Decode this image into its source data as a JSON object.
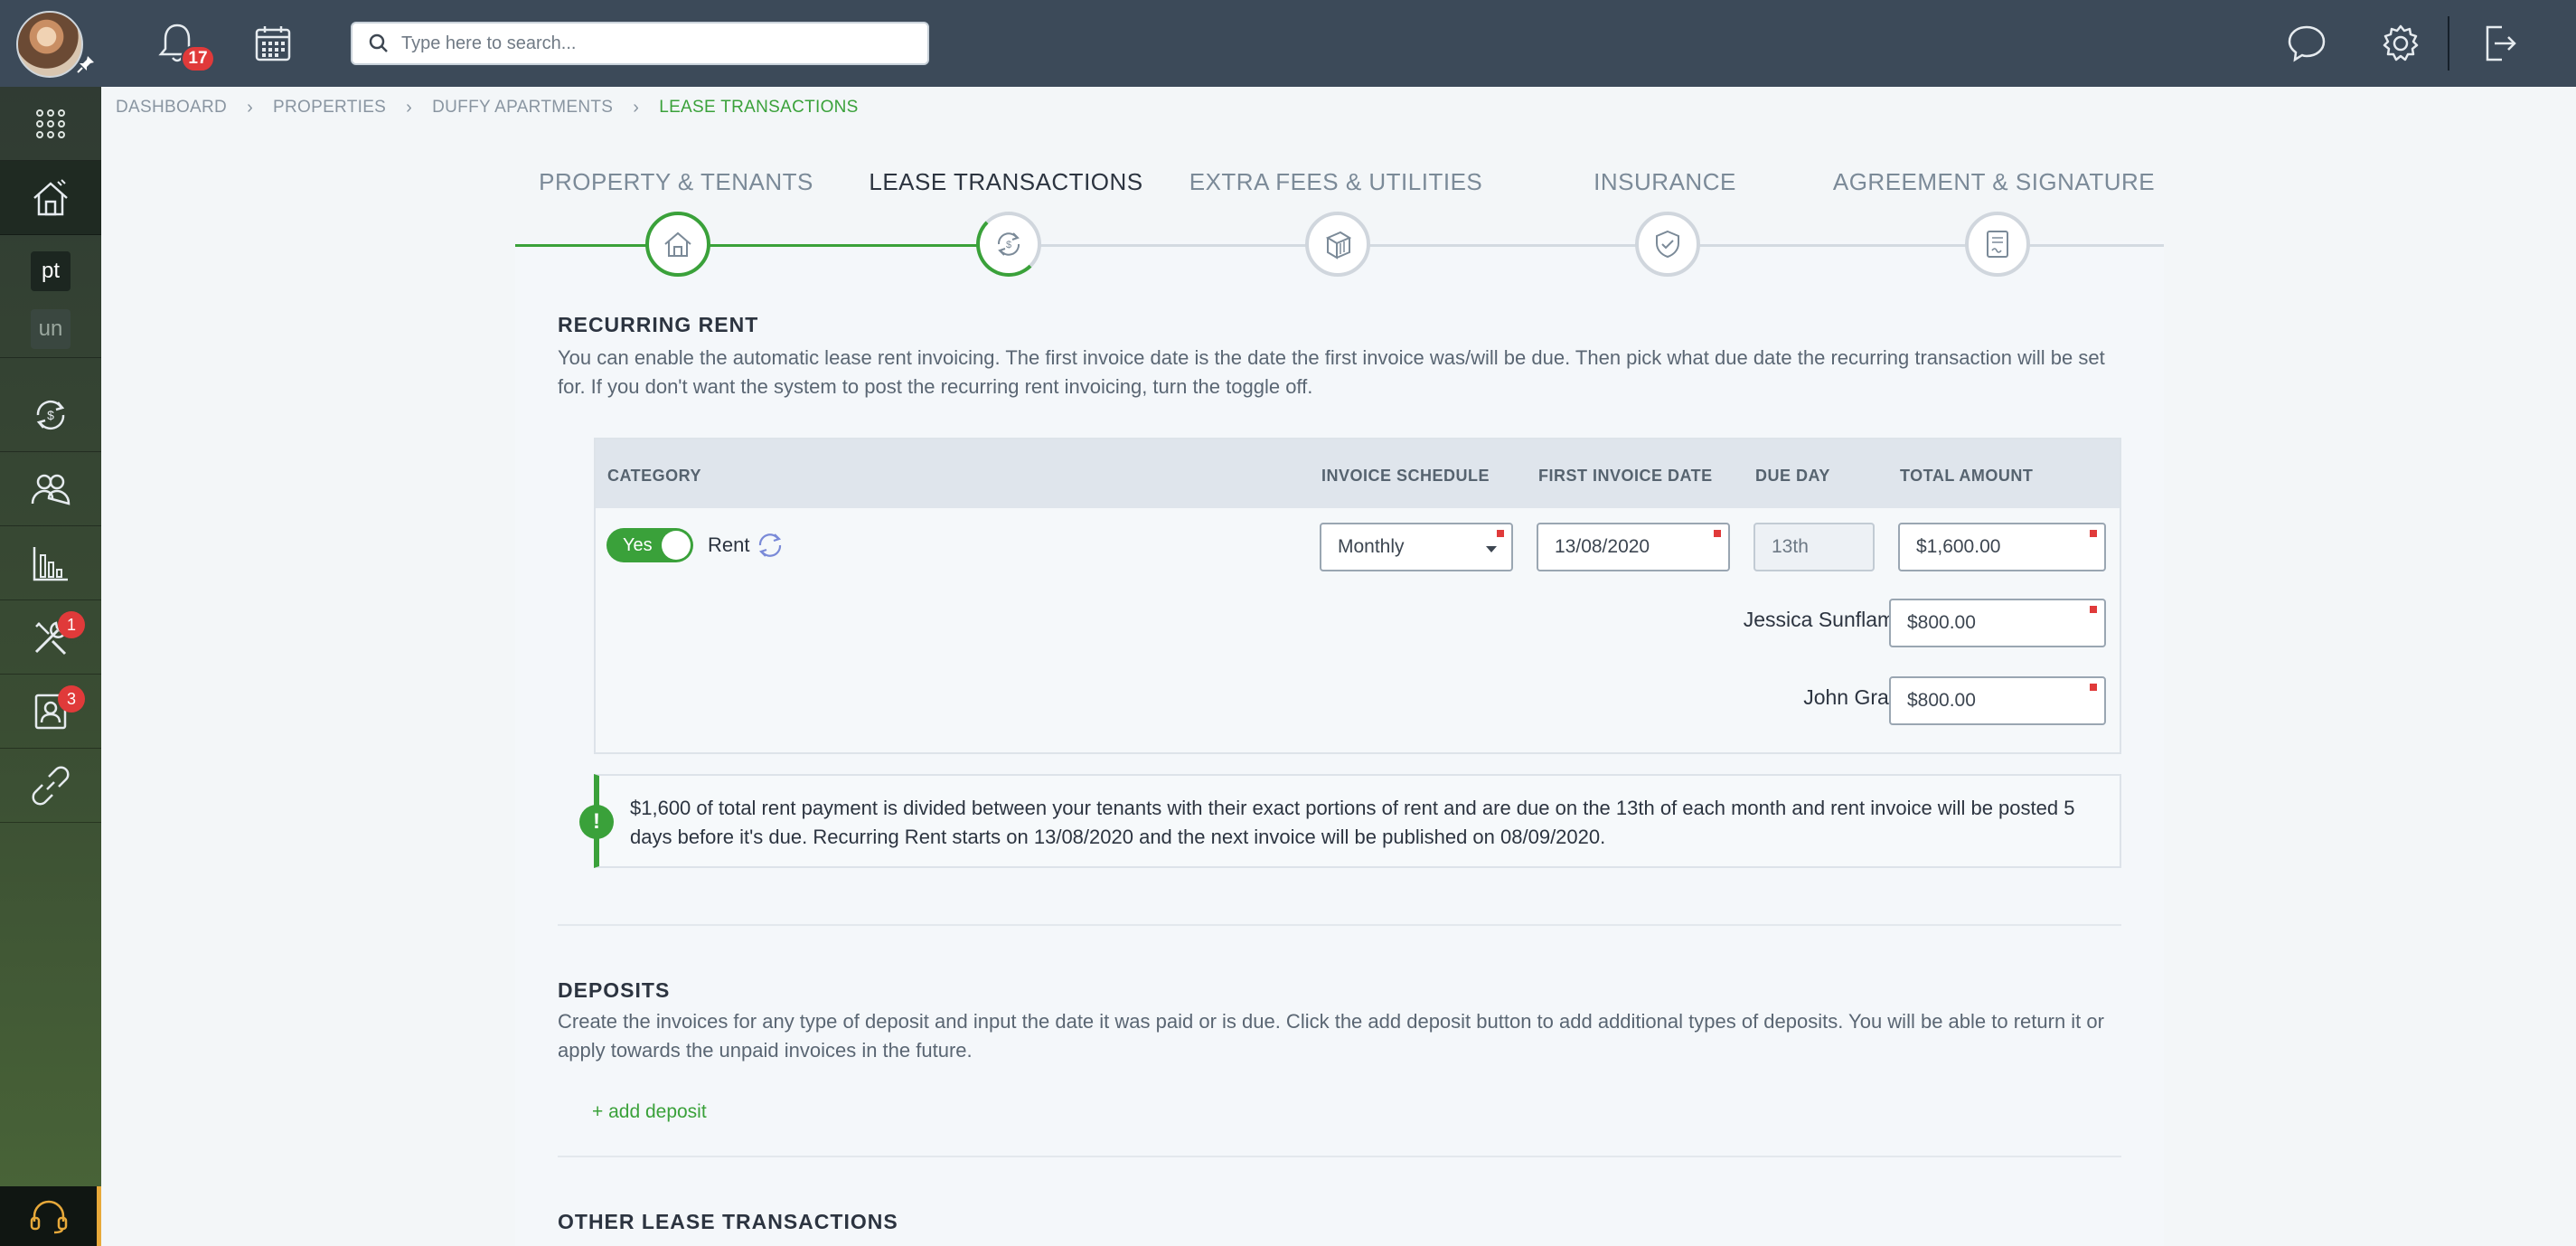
{
  "topbar": {
    "notification_count": "17",
    "search_placeholder": "Type here to search..."
  },
  "sidebar": {
    "items": [
      {
        "icon": "apps-grid-icon"
      },
      {
        "icon": "properties-icon",
        "active": true
      },
      {
        "text": "pt"
      },
      {
        "text": "un"
      },
      {
        "icon": "rent-cycle-icon"
      },
      {
        "icon": "tenants-icon"
      },
      {
        "icon": "reports-icon"
      },
      {
        "icon": "maintenance-icon",
        "badge": "1"
      },
      {
        "icon": "contacts-icon",
        "badge": "3"
      },
      {
        "icon": "link-icon"
      }
    ]
  },
  "breadcrumb": [
    "DASHBOARD",
    "PROPERTIES",
    "DUFFY APARTMENTS",
    "LEASE TRANSACTIONS"
  ],
  "steps": [
    {
      "label": "PROPERTY & TENANTS",
      "state": "done"
    },
    {
      "label": "LEASE TRANSACTIONS",
      "state": "current"
    },
    {
      "label": "EXTRA FEES & UTILITIES",
      "state": "todo"
    },
    {
      "label": "INSURANCE",
      "state": "todo"
    },
    {
      "label": "AGREEMENT & SIGNATURE",
      "state": "todo"
    }
  ],
  "recurring_rent": {
    "title": "RECURRING RENT",
    "description": "You can enable the automatic lease rent invoicing. The first invoice date is the date the first invoice was/will be due. Then pick what due date the recurring transaction will be set for. If you don't want the system to post the recurring rent invoicing, turn the toggle off.",
    "columns": [
      "CATEGORY",
      "INVOICE SCHEDULE",
      "FIRST INVOICE DATE",
      "DUE DAY",
      "TOTAL AMOUNT"
    ],
    "toggle_label": "Yes",
    "category": "Rent",
    "schedule": "Monthly",
    "first_invoice_date": "13/08/2020",
    "due_day": "13th",
    "total_amount": "$1,600.00",
    "tenants": [
      {
        "name": "Jessica Sunflame",
        "amount": "$800.00"
      },
      {
        "name": "John Grant",
        "amount": "$800.00"
      }
    ],
    "alert": "$1,600 of total rent payment is divided between your tenants with their exact portions of rent and are due on the 13th of each month and rent invoice will be posted 5 days before it's due. Recurring Rent starts on 13/08/2020 and the next invoice will be published on 08/09/2020."
  },
  "deposits": {
    "title": "DEPOSITS",
    "description": "Create the invoices for any type of deposit and input the date it was paid or is due. Click the add deposit button to add additional types of deposits. You will be able to return it or apply towards the unpaid invoices in the future.",
    "add_label": "+ add deposit"
  },
  "other_transactions": {
    "title": "OTHER LEASE TRANSACTIONS"
  },
  "colors": {
    "topbar": "#3c4a59",
    "accent_green": "#3aa13a",
    "badge_red": "#e03a3a"
  }
}
